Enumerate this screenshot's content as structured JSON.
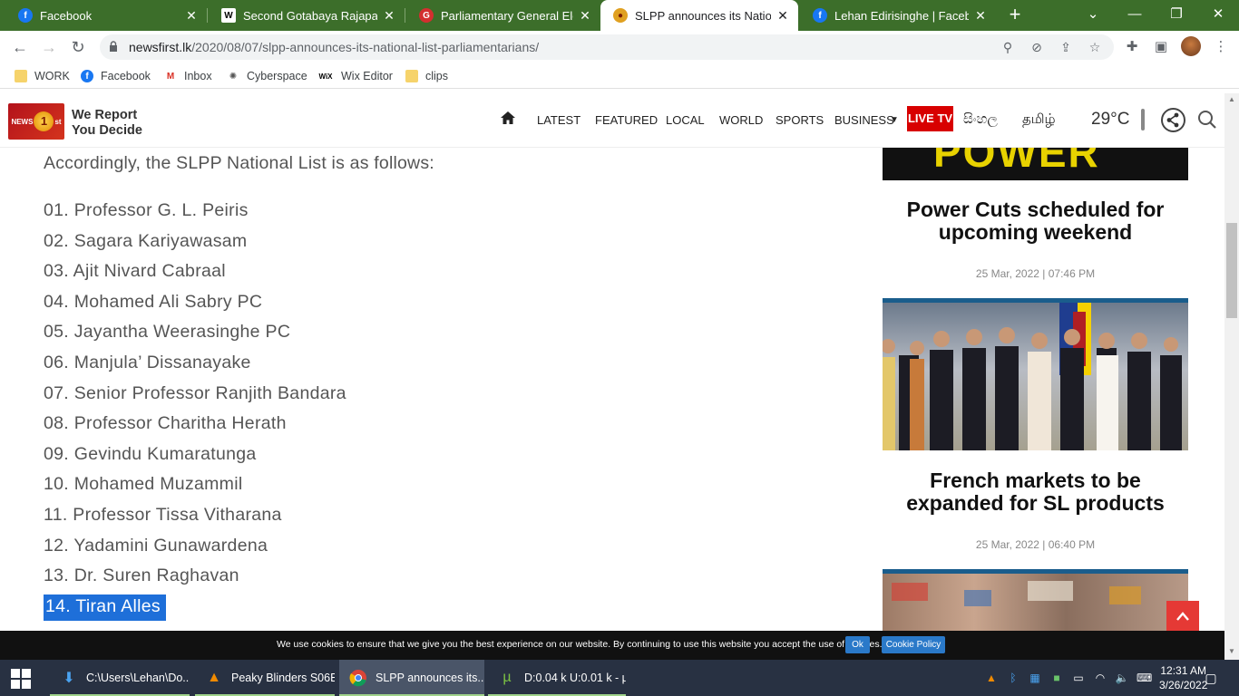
{
  "browser": {
    "tabs": [
      {
        "title": "Facebook",
        "icon": "facebook-icon",
        "active": false
      },
      {
        "title": "Second Gotabaya Rajapaksa",
        "icon": "wikipedia-icon",
        "active": false
      },
      {
        "title": "Parliamentary General Electio",
        "icon": "g-icon",
        "active": false
      },
      {
        "title": "SLPP announces its National",
        "icon": "newsfirst-icon",
        "active": true
      },
      {
        "title": "Lehan Edirisinghe | Facebook",
        "icon": "facebook-icon",
        "active": false
      }
    ],
    "url_host": "newsfirst.lk",
    "url_path": "/2020/08/07/slpp-announces-its-national-list-parliamentarians/",
    "bookmarks": [
      "WORK",
      "Facebook",
      "Inbox",
      "Cyberspace",
      "Wix Editor",
      "clips"
    ]
  },
  "site": {
    "tagline_1": "We Report",
    "tagline_2": "You Decide",
    "nav": [
      "LATEST",
      "FEATURED",
      "LOCAL",
      "WORLD",
      "SPORTS",
      "BUSINESS"
    ],
    "live_tv": "LIVE TV",
    "lang_si": "සිංහල",
    "lang_ta": "தமிழ்",
    "temperature": "29°C"
  },
  "article": {
    "intro": "Accordingly, the SLPP National List is as follows:",
    "list": [
      "01. Professor G. L. Peiris",
      "02. Sagara Kariyawasam",
      "03. Ajit Nivard Cabraal",
      "04. Mohamed Ali Sabry PC",
      "05. Jayantha Weerasinghe PC",
      "06. Manjula’ Dissanayake",
      "07. Senior Professor Ranjith Bandara",
      "08. Professor Charitha Herath",
      "09. Gevindu Kumaratunga",
      "10. Mohamed Muzammil",
      "11. Professor Tissa Vitharana",
      "12. Yadamini Gunawardena",
      "13. Dr. Suren Raghavan",
      "14. Tiran Alles"
    ]
  },
  "sidebar": {
    "banner_text": "POWER CUT",
    "items": [
      {
        "title": "Power Cuts scheduled for upcoming weekend",
        "date": "25 Mar, 2022 | 07:46 PM"
      },
      {
        "title": "French markets to be expanded for SL products",
        "date": "25 Mar, 2022 | 06:40 PM"
      }
    ]
  },
  "cookie": {
    "text": "We use cookies to ensure that we give you the best experience on our website. By continuing to use this website you accept the use of cookies.",
    "ok": "Ok",
    "policy": "Cookie Policy"
  },
  "taskbar": {
    "items": [
      {
        "label": "C:\\Users\\Lehan\\Do...",
        "icon": "download-folder-icon"
      },
      {
        "label": "Peaky Blinders S06E...",
        "icon": "vlc-icon"
      },
      {
        "label": "SLPP announces its...",
        "icon": "chrome-icon"
      },
      {
        "label": "D:0.04 k U:0.01 k - µ...",
        "icon": "utorrent-icon"
      }
    ],
    "time": "12:31 AM",
    "date": "3/26/2022"
  },
  "colors": {
    "tabstrip": "#3c6e2a",
    "live_tv": "#d80000",
    "selection": "#1e6fd9",
    "accent_blue": "#1a5d8c"
  }
}
